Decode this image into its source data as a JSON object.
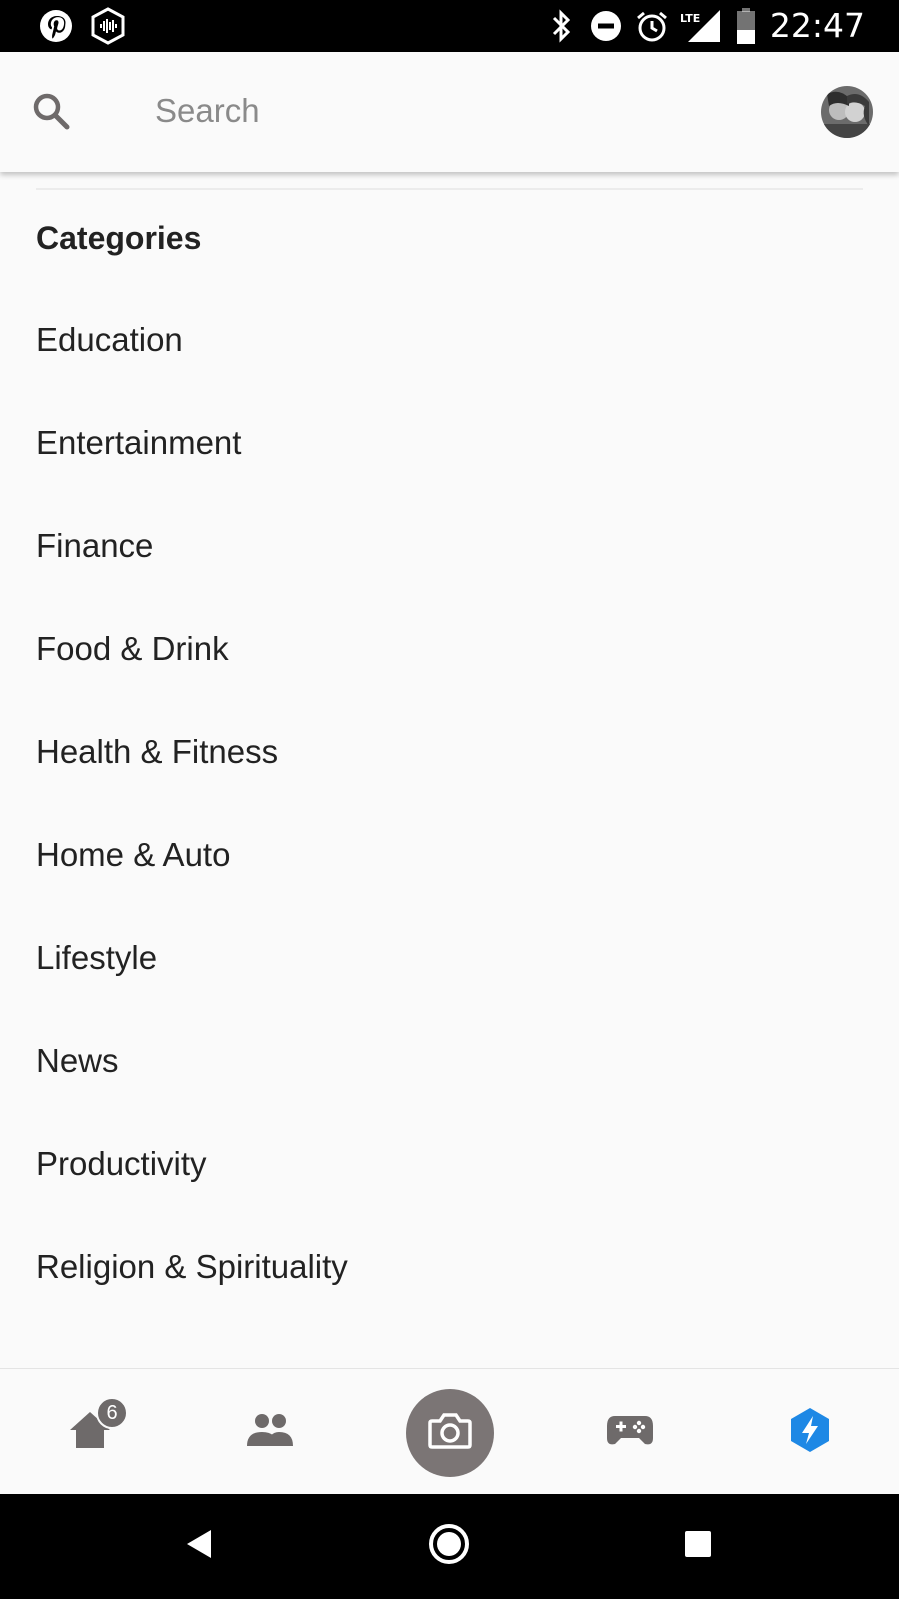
{
  "status_bar": {
    "time": "22:47",
    "left_icons": [
      "pinterest-icon",
      "podcast-icon"
    ],
    "right_icons": [
      "bluetooth-icon",
      "do-not-disturb-icon",
      "alarm-icon",
      "lte-signal-icon",
      "battery-icon"
    ],
    "network_label": "LTE"
  },
  "search": {
    "placeholder": "Search",
    "value": ""
  },
  "categories": {
    "title": "Categories",
    "items": [
      {
        "label": "Education"
      },
      {
        "label": "Entertainment"
      },
      {
        "label": "Finance"
      },
      {
        "label": "Food & Drink"
      },
      {
        "label": "Health & Fitness"
      },
      {
        "label": "Home & Auto"
      },
      {
        "label": "Lifestyle"
      },
      {
        "label": "News"
      },
      {
        "label": "Productivity"
      },
      {
        "label": "Religion & Spirituality"
      }
    ]
  },
  "bottom_nav": {
    "home_badge": "6",
    "items": [
      "home-icon",
      "friends-icon",
      "camera-icon",
      "games-icon",
      "discover-icon"
    ],
    "active": "discover-icon",
    "accent_color": "#1e88e5",
    "icon_color": "#6e6a6a"
  },
  "system_nav": [
    "back-icon",
    "home-circle-icon",
    "recents-icon"
  ]
}
